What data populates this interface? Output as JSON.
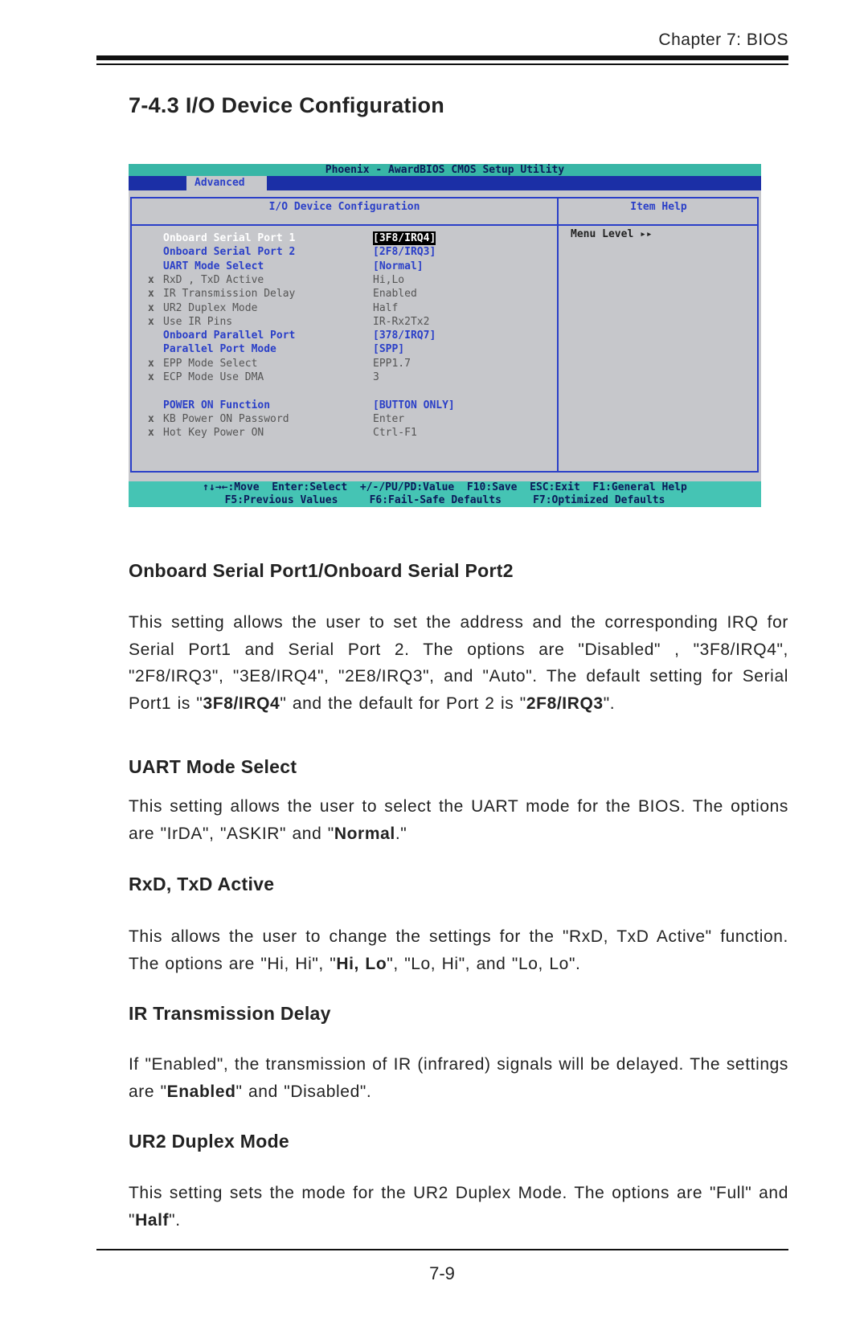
{
  "header": {
    "chapter": "Chapter 7: BIOS"
  },
  "section_title": "7-4.3  I/O Device Configuration",
  "bios": {
    "title": "Phoenix - AwardBIOS CMOS Setup Utility",
    "tab": "Advanced",
    "panel_title": "I/O Device Configuration",
    "help_title": "Item Help",
    "menu_level": "Menu Level   ▸▸",
    "rows": [
      {
        "x": "",
        "label": "Onboard Serial Port 1",
        "value": "[3F8/IRQ4]"
      },
      {
        "x": "",
        "label": "Onboard Serial Port 2",
        "value": "[2F8/IRQ3]"
      },
      {
        "x": "",
        "label": "UART Mode Select",
        "value": "[Normal]"
      },
      {
        "x": "x",
        "label": "RxD , TxD Active",
        "value": "Hi,Lo"
      },
      {
        "x": "x",
        "label": "IR Transmission Delay",
        "value": "Enabled"
      },
      {
        "x": "x",
        "label": "UR2 Duplex Mode",
        "value": "Half"
      },
      {
        "x": "x",
        "label": "Use IR Pins",
        "value": "IR-Rx2Tx2"
      },
      {
        "x": "",
        "label": "Onboard Parallel Port",
        "value": "[378/IRQ7]"
      },
      {
        "x": "",
        "label": "Parallel Port Mode",
        "value": "[SPP]"
      },
      {
        "x": "x",
        "label": "EPP Mode Select",
        "value": "EPP1.7"
      },
      {
        "x": "x",
        "label": "ECP Mode Use DMA",
        "value": "3"
      },
      {
        "x": "",
        "label": "POWER ON Function",
        "value": "[BUTTON ONLY]"
      },
      {
        "x": "x",
        "label": "KB Power ON Password",
        "value": "Enter"
      },
      {
        "x": "x",
        "label": "Hot Key Power ON",
        "value": "Ctrl-F1"
      }
    ],
    "footer1": "↑↓→←:Move  Enter:Select  +/-/PU/PD:Value  F10:Save  ESC:Exit  F1:General Help",
    "footer2": "F5:Previous Values     F6:Fail-Safe Defaults     F7:Optimized Defaults",
    "colors": {
      "title_bar": "#38b6a6",
      "tab_bar": "#1b2fa6",
      "panel": "#c6c7cb",
      "accent": "#2a3fc8"
    }
  },
  "sections": [
    {
      "heading": "Onboard Serial Port1/Onboard Serial Port2",
      "p": [
        "This setting allows the user to set  the address and the corresponding IRQ for  Serial Port1 and Serial Port 2.   The options are \"Disabled\" , \"3F8/IRQ4\", \"2F8/IRQ3\", \"3E8/IRQ4\", \"2E8/IRQ3\", and \"Auto\".   The default setting for Serial Port1 is \"",
        "3F8/IRQ4",
        "\" and the default for Port 2 is \"",
        "2F8/IRQ3",
        "\"."
      ]
    },
    {
      "heading": "UART Mode Select",
      "p": [
        "This setting allows the user to select the UART mode for the BIOS.   The options are \"IrDA\", \"ASKIR\" and \"",
        "Normal",
        ".\""
      ]
    },
    {
      "heading": "RxD, TxD Active",
      "p": [
        "This allows the user to change the settings for the \"RxD, TxD Active\" function.   The options are \"Hi, Hi\", \"",
        "Hi, Lo",
        "\", \"Lo, Hi\",  and \"Lo, Lo\"."
      ]
    },
    {
      "heading": "IR Transmission Delay",
      "p": [
        "If \"Enabled\", the transmission of IR (infrared) signals will be delayed.  The settings are \"",
        "Enabled",
        "\" and \"Disabled\"."
      ]
    },
    {
      "heading": "UR2 Duplex Mode",
      "p": [
        "This setting sets the mode for the UR2 Duplex Mode.  The options are \"Full\" and \"",
        "Half",
        "\"."
      ]
    }
  ],
  "page_number": "7-9"
}
